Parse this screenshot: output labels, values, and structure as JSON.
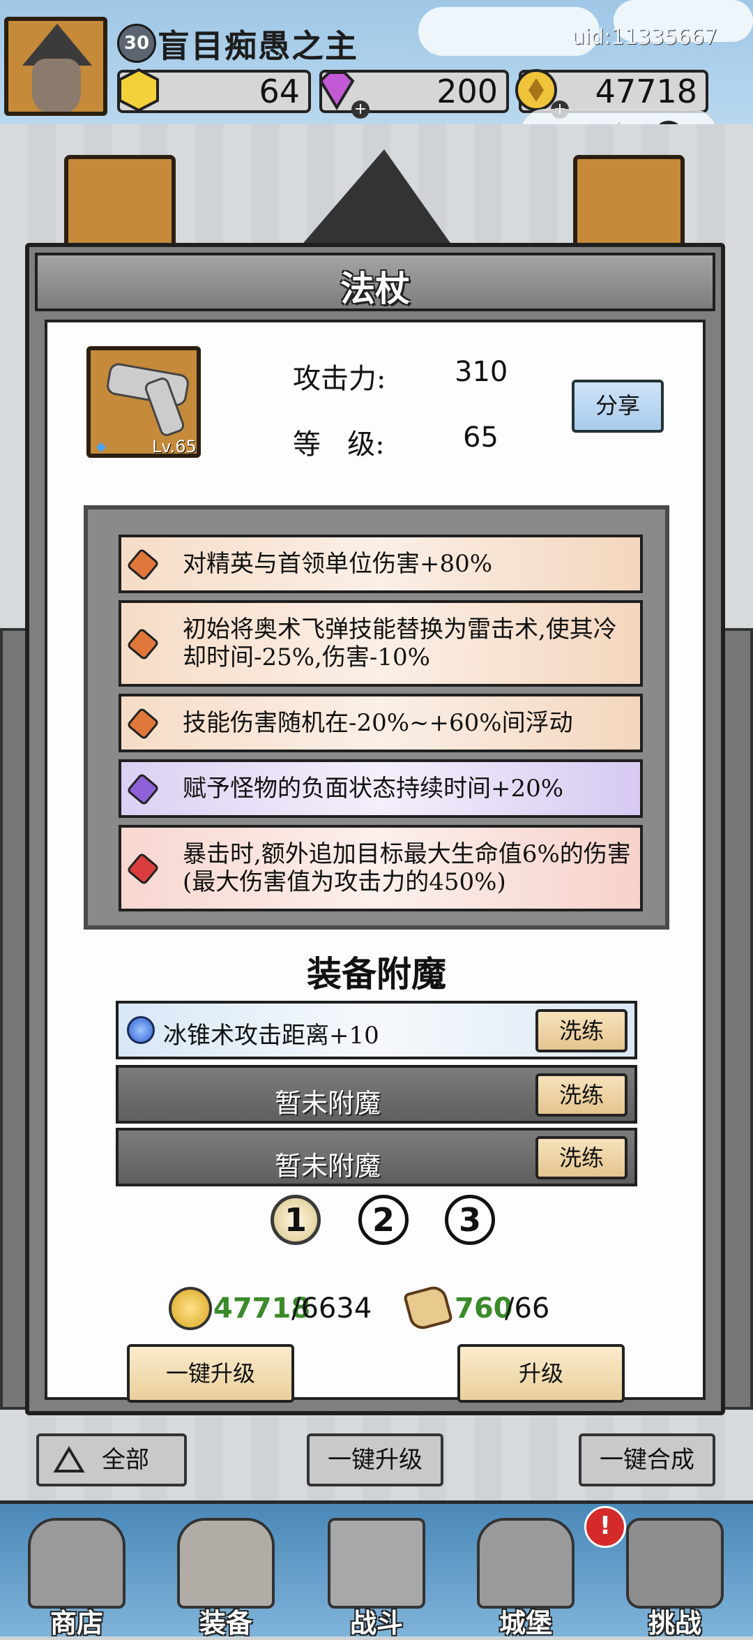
{
  "header": {
    "player_level": "30",
    "player_name": "盲目痴愚之主",
    "uid": "uid:11335667",
    "gold_small": "64",
    "gems": "200",
    "coins": "47718"
  },
  "modal": {
    "title": "法杖",
    "item_level": "Lv.65",
    "attack_label": "攻击力:",
    "attack_value": "310",
    "level_label": "等   级:",
    "level_value": "65",
    "share_label": "分享",
    "affixes": [
      {
        "rarity": "orange",
        "text": "对精英与首领单位伤害+80%"
      },
      {
        "rarity": "orange",
        "text": "初始将奥术飞弹技能替换为雷击术,使其冷却时间-25%,伤害-10%"
      },
      {
        "rarity": "orange",
        "text": "技能伤害随机在-20%~+60%间浮动"
      },
      {
        "rarity": "purple",
        "text": "赋予怪物的负面状态持续时间+20%"
      },
      {
        "rarity": "red",
        "text": "暴击时,额外追加目标最大生命值6%的伤害(最大伤害值为攻击力的450%)"
      }
    ],
    "enchant_title": "装备附魔",
    "enchants": [
      {
        "text": "冰锥术攻击距离+10",
        "button": "洗练"
      },
      {
        "text": "暂未附魔",
        "button": "洗练"
      },
      {
        "text": "暂未附魔",
        "button": "洗练"
      }
    ],
    "pages": [
      "1",
      "2",
      "3"
    ],
    "active_page": 1,
    "cost": {
      "gold_have": "47718",
      "gold_need": "/6634",
      "scroll_have": "760",
      "scroll_need": "/66"
    },
    "one_click_upgrade": "一键升级",
    "upgrade": "升级"
  },
  "bottom_buttons": {
    "all": "全部",
    "one_click_upgrade": "一键升级",
    "one_click_merge": "一键合成"
  },
  "nav": {
    "items": [
      "商店",
      "装备",
      "战斗",
      "城堡",
      "挑战"
    ],
    "alert_badge": "!"
  },
  "colors": {
    "have_amount": "#3a8a2a",
    "enchant_filled": "#dbe8f5",
    "enchant_empty": "#6b6b6b"
  }
}
